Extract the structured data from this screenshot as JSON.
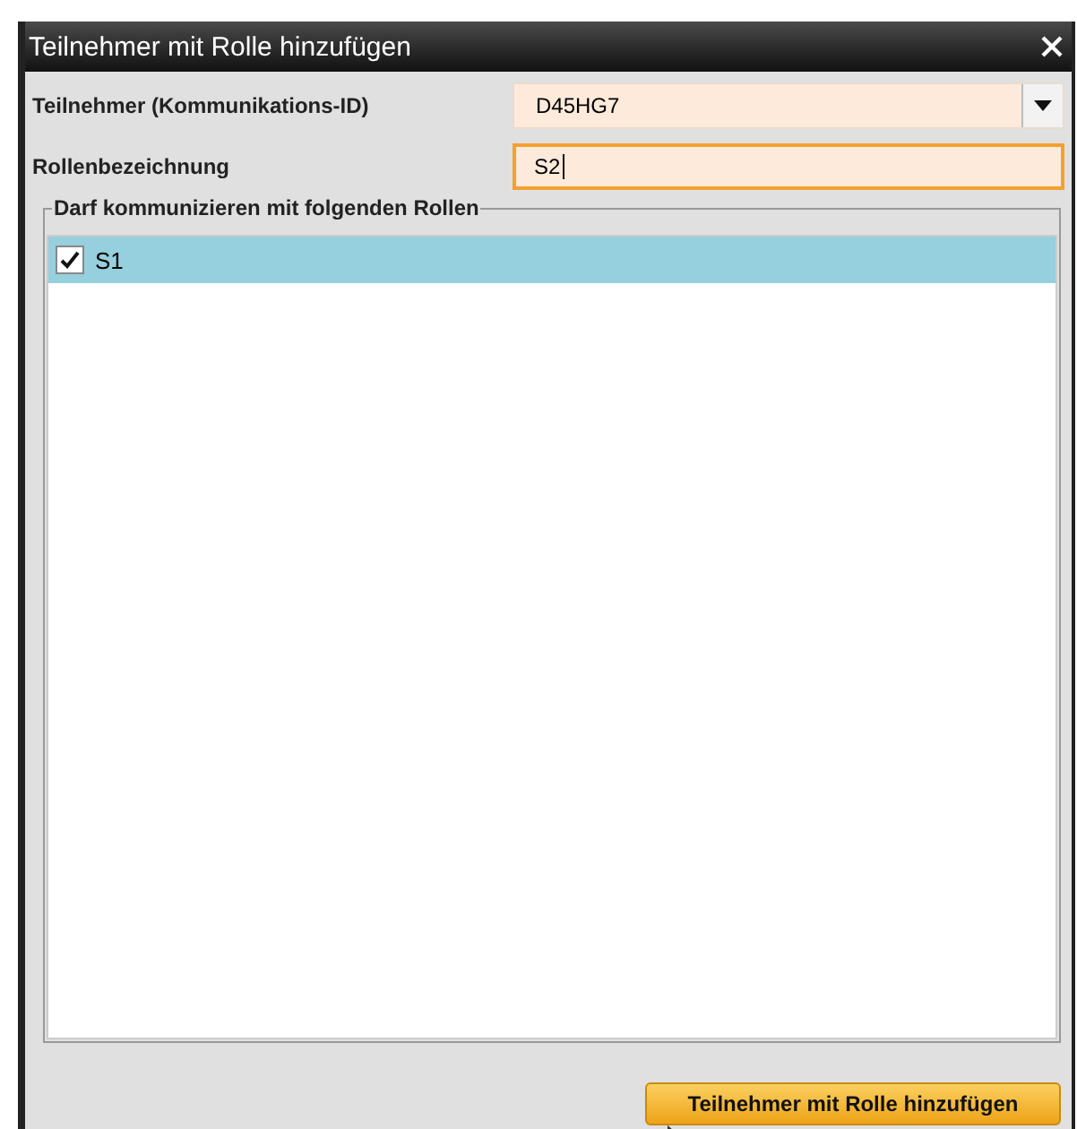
{
  "window": {
    "title": "Teilnehmer mit Rolle hinzufügen"
  },
  "fields": [
    {
      "kind": "dropdown",
      "label": "Teilnehmer (Kommunikations-ID)",
      "value": "D45HG7",
      "focused": false
    },
    {
      "kind": "text",
      "label": "Rollenbezeichnung",
      "value": "S2",
      "focused": true
    }
  ],
  "group": {
    "title": "Darf kommunizieren mit folgenden Rollen",
    "items": [
      {
        "label": "S1",
        "checked": true,
        "selected": true
      }
    ]
  },
  "button": "Teilnehmer mit Rolle hinzufügen"
}
